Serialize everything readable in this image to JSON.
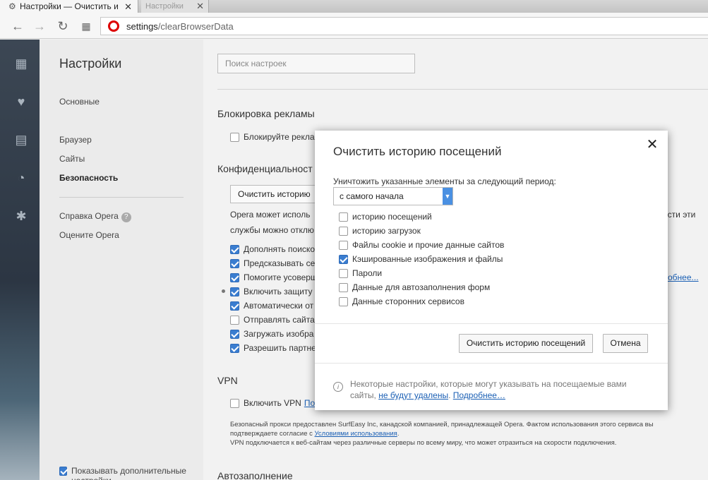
{
  "browser": {
    "active_tab_title": "Настройки — Очистить и",
    "inactive_tab_title": "Настройки",
    "url_host": "settings",
    "url_path": "/clearBrowserData"
  },
  "sidebar_icons": [
    "speed-dial-icon",
    "heart-icon",
    "news-icon",
    "history-icon",
    "extensions-icon"
  ],
  "nav": {
    "title": "Настройки",
    "items": [
      "Основные",
      "Браузер",
      "Сайты",
      "Безопасность"
    ],
    "active": "Безопасность",
    "help": "Справка Opera",
    "rate": "Оцените Opera",
    "show_more": "Показывать дополнительные настройки"
  },
  "search": {
    "placeholder": "Поиск настроек"
  },
  "sections": {
    "ads": {
      "title": "Блокировка рекламы",
      "option": "Блокируйте рекла"
    },
    "privacy": {
      "title": "Конфиденциальност",
      "clear_button": "Очистить историю",
      "text_line1": "Opera может исполь",
      "text_line1_tail": "ости эти",
      "text_line2": "службы можно отклю",
      "options": [
        {
          "label": "Дополнять поиско",
          "checked": true
        },
        {
          "label": "Предсказывать се",
          "checked": true
        },
        {
          "label": "Помогите усоверш",
          "checked": true
        },
        {
          "label": "Включить защиту",
          "checked": true
        },
        {
          "label": "Автоматически от",
          "checked": true
        },
        {
          "label": "Отправлять сайта",
          "checked": false
        },
        {
          "label": "Загружать изобра",
          "checked": true
        },
        {
          "label": "Разрешить партне",
          "checked": true
        }
      ],
      "more_link_tail": "обнее..."
    },
    "vpn": {
      "title": "VPN",
      "option": "Включить VPN",
      "option_link": "По",
      "fine_print_1": "Безопасный прокси предоставлен SurfEasy Inc, канадской компанией, принадлежащей Opera. Фактом использования этого сервиса вы",
      "fine_print_2_pre": "подтверждаете согласие с ",
      "fine_print_2_link": "Условиями использования",
      "fine_print_2_post": ".",
      "fine_print_3": "VPN подключается к веб-сайтам через различные серверы по всему миру, что может отразиться на скорости подключения."
    },
    "autofill": {
      "title": "Автозаполнение"
    }
  },
  "modal": {
    "title": "Очистить историю посещений",
    "period_label": "Уничтожить указанные элементы за следующий период:",
    "period_value": "с самого начала",
    "items": [
      {
        "label": "историю посещений",
        "checked": false
      },
      {
        "label": "историю загрузок",
        "checked": false
      },
      {
        "label": "Файлы cookie и прочие данные сайтов",
        "checked": false
      },
      {
        "label": "Кэшированные изображения и файлы",
        "checked": true
      },
      {
        "label": "Пароли",
        "checked": false
      },
      {
        "label": "Данные для автозаполнения форм",
        "checked": false
      },
      {
        "label": "Данные сторонних сервисов",
        "checked": false
      }
    ],
    "confirm_button": "Очистить историю посещений",
    "cancel_button": "Отмена",
    "note_text": "Некоторые настройки, которые могут указывать на посещаемые вами",
    "note_text2": "сайты,",
    "note_link1": "не будут удалены",
    "note_link2": "Подробнее…"
  },
  "colors": {
    "accent": "#3a7dd0",
    "link": "#1a5fb4",
    "sidebar_dark": "#2c3643"
  }
}
